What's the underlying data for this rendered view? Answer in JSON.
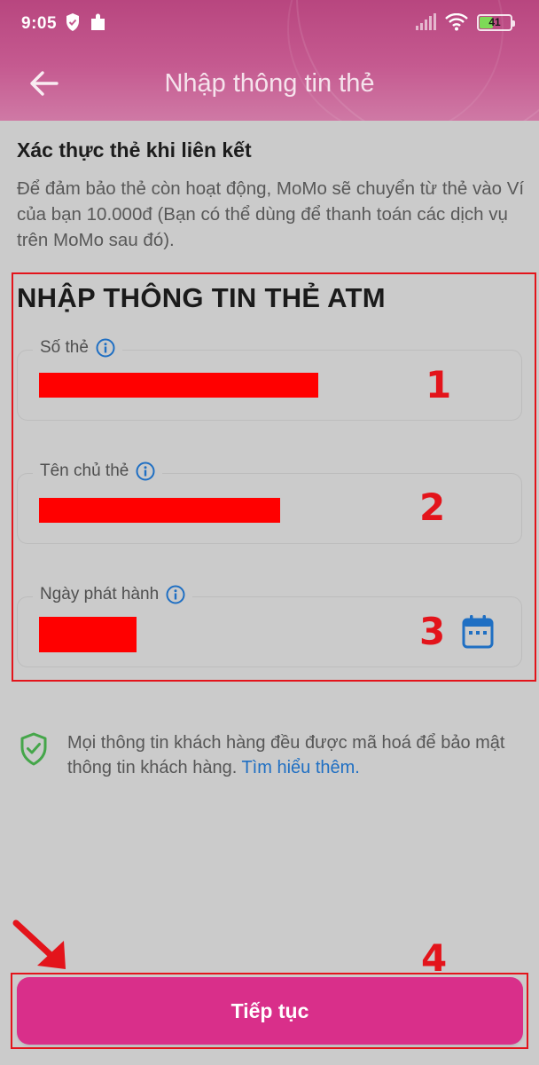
{
  "status_bar": {
    "time": "9:05",
    "battery": "41",
    "icons": [
      "shield-status-icon",
      "puzzle-status-icon",
      "signal-icon",
      "wifi-icon",
      "battery-icon"
    ]
  },
  "header": {
    "title": "Nhập thông tin thẻ",
    "back_icon": "arrow-left-icon",
    "background_color": "#c55a90"
  },
  "verification": {
    "title": "Xác thực thẻ khi liên kết",
    "description": "Để đảm bảo thẻ còn hoạt động, MoMo sẽ chuyển từ thẻ vào Ví của bạn 10.000đ (Bạn có thể dùng để thanh toán các dịch vụ trên MoMo sau đó)."
  },
  "card_form": {
    "heading": "NHẬP THÔNG TIN THẺ ATM",
    "fields": [
      {
        "label": "Số thẻ",
        "marker": "1",
        "value_redacted": true
      },
      {
        "label": "Tên chủ thẻ",
        "marker": "2",
        "value_redacted": true
      },
      {
        "label": "Ngày phát hành",
        "marker": "3",
        "value_redacted": true,
        "icon": "calendar-icon"
      }
    ]
  },
  "security_note": {
    "text": "Mọi thông tin khách hàng đều được mã hoá để bảo mật thông tin khách hàng. ",
    "link": "Tìm hiểu thêm.",
    "icon": "shield-check-icon"
  },
  "footer": {
    "marker": "4",
    "continue_label": "Tiếp tục",
    "button_color": "#d92f8a"
  },
  "annotation_color": "#e3141b"
}
